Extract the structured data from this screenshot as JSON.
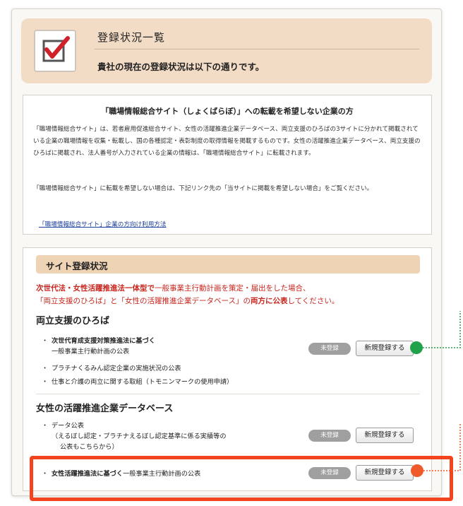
{
  "header": {
    "title": "登録状況一覧",
    "subtitle": "貴社の現在の登録状況は以下の通りです。",
    "icon": "checkbox-check-icon"
  },
  "notice": {
    "heading": "「職場情報総合サイト（しょくばらぼ）」への転載を希望しない企業の方",
    "para1": "「職場情報総合サイト」は、若者雇用促進総合サイト、女性の活躍推進企業データベース、両立支援のひろばの3サイトに分かれて掲載されている企業の職場情報を収集・転載し、国の各種認定・表彰制度の取得情報を掲載するものです。女性の活躍推進企業データベース、両立支援のひろばに掲載され、法人番号が入力されている企業の情報は、「職場情報総合サイト」に転載されます。",
    "para2": "「職場情報総合サイト」に転載を希望しない場合は、下記リンク先の「当サイトに掲載を希望しない場合」をご覧ください。",
    "link": "「職場情報総合サイト」企業の方向け利用方法"
  },
  "registration": {
    "section_label": "サイト登録状況",
    "notice_line1_bold": "次世代法・女性活躍推進法一体型で",
    "notice_line1_rest": "一般事業主行動計画を策定・届出をした場合、",
    "notice_line2_a": "「両立支援のひろば」と「女性の活躍推進企業データベース」の",
    "notice_line2_bold": "両方に公表",
    "notice_line2_b": "してください。",
    "group1": {
      "title": "両立支援のひろば",
      "items": [
        {
          "text_line1": "次世代育成支援対策推進法に基づく",
          "text_line2": "一般事業主行動計画の公表",
          "status": "未登録",
          "button": "新規登録する"
        },
        {
          "text_line1": "プラチナくるみん認定企業の実施状況の公表"
        },
        {
          "text_line1": "仕事と介護の両立に関する取組（トモニンマークの使用申請）"
        }
      ]
    },
    "group2": {
      "title": "女性の活躍推進企業データベース",
      "items": [
        {
          "text_line1": "データ公表",
          "text_line2": "（えるぼし認定・プラチナえるぼし認定基準に係る実績等の",
          "text_line3": "公表もこちらから）",
          "status": "未登録",
          "button": "新規登録する"
        },
        {
          "text_bold": "女性活躍推進法に基づく",
          "text_rest": "一般事業主行動計画の公表",
          "status": "未登録",
          "button": "新規登録する"
        }
      ]
    },
    "bullet": "・"
  },
  "colors": {
    "accent_red": "#c8251d",
    "highlight": "#f2441f",
    "callout_green": "#1fa24a",
    "callout_orange": "#ee5a2a",
    "header_bg": "#f3dcc6",
    "status_pill": "#9f9f9f"
  }
}
